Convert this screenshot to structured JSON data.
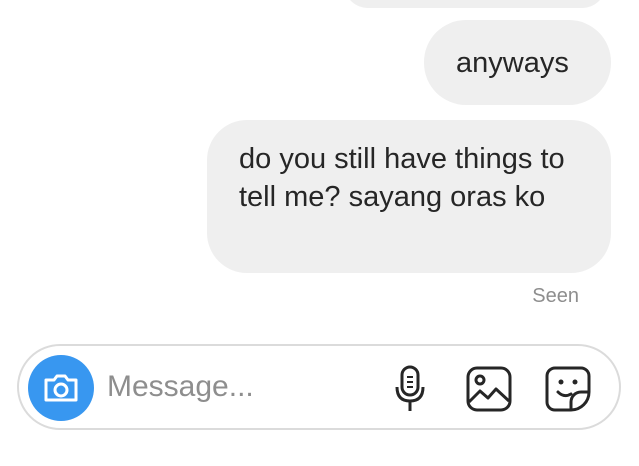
{
  "thread": {
    "messages": [
      {
        "text": ""
      },
      {
        "text": "anyways"
      },
      {
        "text": "do you still have things to tell me? sayang oras ko"
      }
    ],
    "seen_label": "Seen"
  },
  "composer": {
    "placeholder": "Message...",
    "icons": {
      "camera": "camera-icon",
      "mic": "microphone-icon",
      "gallery": "image-icon",
      "sticker": "sticker-icon"
    }
  },
  "colors": {
    "bubble_bg": "#efefef",
    "text": "#262626",
    "muted": "#8e8e8e",
    "accent": "#3897f0",
    "border": "#dbdbdb"
  }
}
